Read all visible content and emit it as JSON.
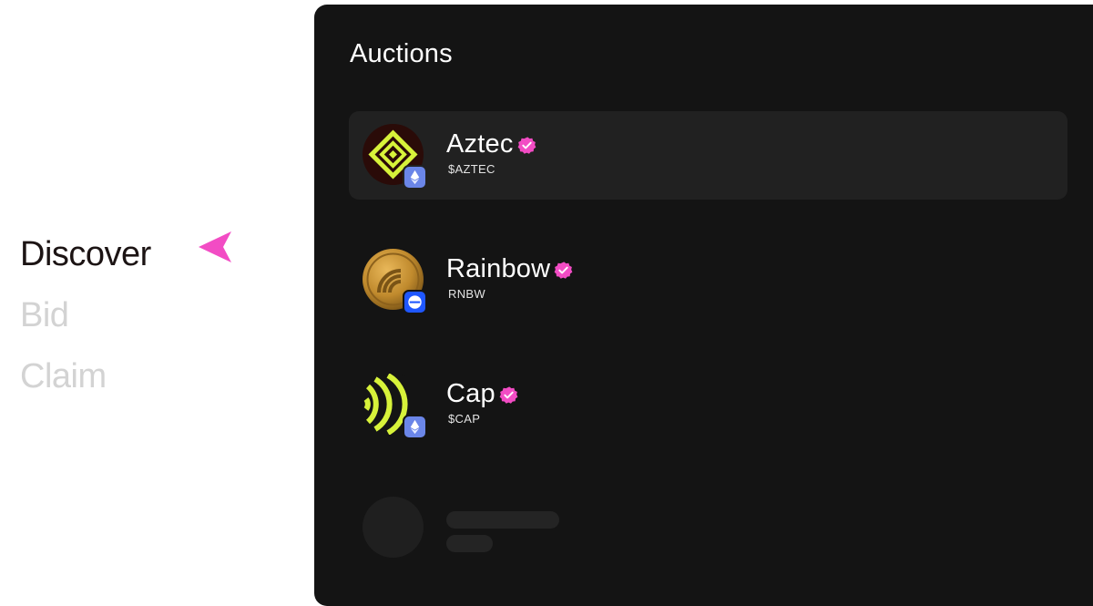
{
  "nav": {
    "items": [
      {
        "label": "Discover",
        "active": true
      },
      {
        "label": "Bid",
        "active": false
      },
      {
        "label": "Claim",
        "active": false
      }
    ],
    "pointer_icon": "arrow-pointer-icon",
    "pointer_color": "#f24cc4"
  },
  "auctions": {
    "title": "Auctions",
    "items": [
      {
        "name": "Aztec",
        "ticker": "$AZTEC",
        "verified": true,
        "logo_icon": "aztec-diamond-icon",
        "chain_icon": "ethereum-icon",
        "selected": true
      },
      {
        "name": "Rainbow",
        "ticker": "RNBW",
        "verified": true,
        "logo_icon": "rainbow-coin-icon",
        "chain_icon": "base-icon",
        "selected": false
      },
      {
        "name": "Cap",
        "ticker": "$CAP",
        "verified": true,
        "logo_icon": "cap-arcs-icon",
        "chain_icon": "ethereum-icon",
        "selected": false
      }
    ],
    "loading_placeholder": true
  },
  "colors": {
    "panel_bg": "#141414",
    "row_selected_bg": "#212121",
    "verified_badge": "#f24cc4",
    "nav_active": "#1c1414",
    "nav_inactive": "#d3d3d3"
  }
}
